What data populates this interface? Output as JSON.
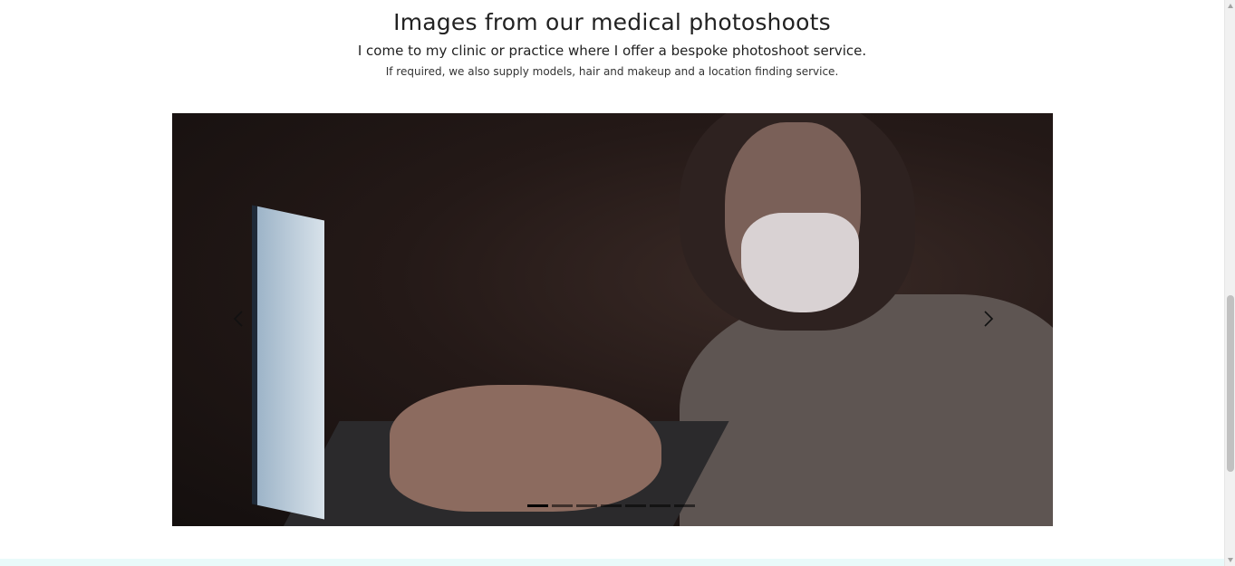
{
  "section": {
    "title": "Images from our medical photoshoots",
    "subtitle": "I come to my clinic or practice where I offer a bespoke photoshoot service.",
    "description": "If required, we also supply models, hair and makeup and a location finding service."
  },
  "carousel": {
    "slides_count": 7,
    "active_slide": 1,
    "prev_icon": "chevron-left-icon",
    "next_icon": "chevron-right-icon"
  },
  "colors": {
    "footer_strip": "#e9fafa",
    "indicator_active": "#000000"
  }
}
